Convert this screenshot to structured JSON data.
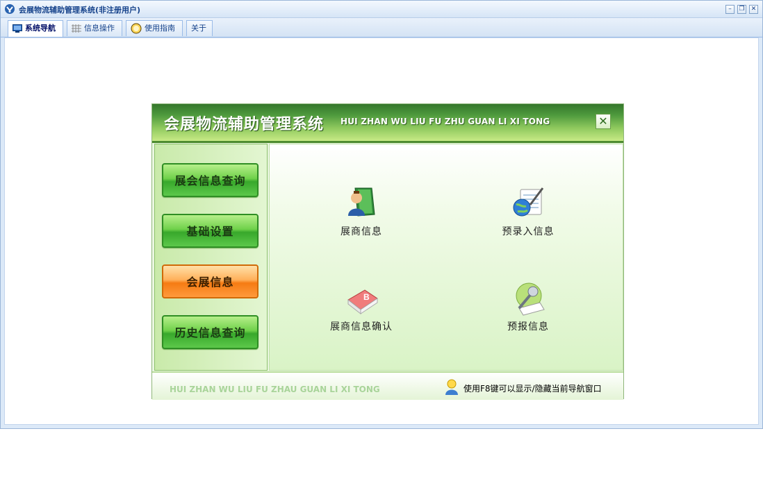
{
  "window": {
    "title": "会展物流辅助管理系统(非注册用户)"
  },
  "tabs": [
    {
      "label": "系统导航",
      "icon": "monitor-icon",
      "active": true
    },
    {
      "label": "信息操作",
      "icon": "grid-icon",
      "active": false
    },
    {
      "label": "使用指南",
      "icon": "lightbulb-icon",
      "active": false
    },
    {
      "label": "关于",
      "icon": "",
      "active": false
    }
  ],
  "nav": {
    "title_cn": "会展物流辅助管理系统",
    "title_en": "HUI ZHAN WU LIU FU ZHU GUAN LI XI TONG",
    "menu": [
      {
        "label": "展会信息查询",
        "style": "green"
      },
      {
        "label": "基础设置",
        "style": "green"
      },
      {
        "label": "会展信息",
        "style": "orange"
      },
      {
        "label": "历史信息查询",
        "style": "green"
      }
    ],
    "items": [
      {
        "label": "展商信息",
        "icon": "exhibitor-book-icon"
      },
      {
        "label": "预录入信息",
        "icon": "globe-notepad-icon"
      },
      {
        "label": "展商信息确认",
        "icon": "stamp-book-icon"
      },
      {
        "label": "预报信息",
        "icon": "microphone-icon"
      }
    ],
    "footer_en": "HUI ZHAN WU LIU FU ZHAU  GUAN LI XI TONG",
    "footer_tip": "使用F8键可以显示/隐藏当前导航窗口"
  },
  "colors": {
    "accent_blue": "#15428b",
    "panel_green": "#4e9a3d",
    "active_orange": "#f57b13"
  }
}
